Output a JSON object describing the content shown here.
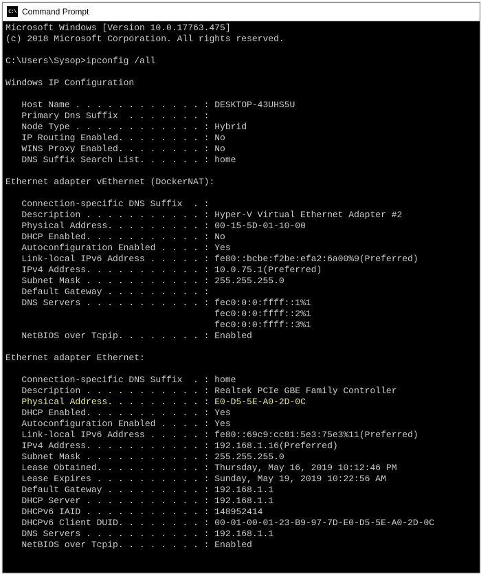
{
  "titlebar": {
    "icon_label": "C:\\",
    "title": "Command Prompt"
  },
  "header": {
    "line1": "Microsoft Windows [Version 10.0.17763.475]",
    "line2": "(c) 2018 Microsoft Corporation. All rights reserved."
  },
  "prompt": {
    "path": "C:\\Users\\Sysop>",
    "command": "ipconfig /all"
  },
  "section_main": "Windows IP Configuration",
  "main": [
    {
      "label": "   Host Name . . . . . . . . . . . . : ",
      "value": "DESKTOP-43UHS5U"
    },
    {
      "label": "   Primary Dns Suffix  . . . . . . . :",
      "value": ""
    },
    {
      "label": "   Node Type . . . . . . . . . . . . : ",
      "value": "Hybrid"
    },
    {
      "label": "   IP Routing Enabled. . . . . . . . : ",
      "value": "No"
    },
    {
      "label": "   WINS Proxy Enabled. . . . . . . . : ",
      "value": "No"
    },
    {
      "label": "   DNS Suffix Search List. . . . . . : ",
      "value": "home"
    }
  ],
  "section_a": "Ethernet adapter vEthernet (DockerNAT):",
  "adapter_a": [
    {
      "label": "   Connection-specific DNS Suffix  . :",
      "value": ""
    },
    {
      "label": "   Description . . . . . . . . . . . : ",
      "value": "Hyper-V Virtual Ethernet Adapter #2"
    },
    {
      "label": "   Physical Address. . . . . . . . . : ",
      "value": "00-15-5D-01-10-00"
    },
    {
      "label": "   DHCP Enabled. . . . . . . . . . . : ",
      "value": "No"
    },
    {
      "label": "   Autoconfiguration Enabled . . . . : ",
      "value": "Yes"
    },
    {
      "label": "   Link-local IPv6 Address . . . . . : ",
      "value": "fe80::bcbe:f2be:efa2:6a00%9(Preferred)"
    },
    {
      "label": "   IPv4 Address. . . . . . . . . . . : ",
      "value": "10.0.75.1(Preferred)"
    },
    {
      "label": "   Subnet Mask . . . . . . . . . . . : ",
      "value": "255.255.255.0"
    },
    {
      "label": "   Default Gateway . . . . . . . . . :",
      "value": ""
    },
    {
      "label": "   DNS Servers . . . . . . . . . . . : ",
      "value": "fec0:0:0:ffff::1%1"
    },
    {
      "label": "                                       ",
      "value": "fec0:0:0:ffff::2%1"
    },
    {
      "label": "                                       ",
      "value": "fec0:0:0:ffff::3%1"
    },
    {
      "label": "   NetBIOS over Tcpip. . . . . . . . : ",
      "value": "Enabled"
    }
  ],
  "section_b": "Ethernet adapter Ethernet:",
  "adapter_b": [
    {
      "label": "   Connection-specific DNS Suffix  . : ",
      "value": "home",
      "hl": false
    },
    {
      "label": "   Description . . . . . . . . . . . : ",
      "value": "Realtek PCIe GBE Family Controller",
      "hl": false
    },
    {
      "label": "   Physical Address. . . . . . . . . : ",
      "value": "E0-D5-5E-A0-2D-0C",
      "hl": true
    },
    {
      "label": "   DHCP Enabled. . . . . . . . . . . : ",
      "value": "Yes",
      "hl": false
    },
    {
      "label": "   Autoconfiguration Enabled . . . . : ",
      "value": "Yes",
      "hl": false
    },
    {
      "label": "   Link-local IPv6 Address . . . . . : ",
      "value": "fe80::69c9:cc81:5e3:75e3%11(Preferred)",
      "hl": false
    },
    {
      "label": "   IPv4 Address. . . . . . . . . . . : ",
      "value": "192.168.1.16(Preferred)",
      "hl": false
    },
    {
      "label": "   Subnet Mask . . . . . . . . . . . : ",
      "value": "255.255.255.0",
      "hl": false
    },
    {
      "label": "   Lease Obtained. . . . . . . . . . : ",
      "value": "Thursday, May 16, 2019 10:12:46 PM",
      "hl": false
    },
    {
      "label": "   Lease Expires . . . . . . . . . . : ",
      "value": "Sunday, May 19, 2019 10:22:56 AM",
      "hl": false
    },
    {
      "label": "   Default Gateway . . . . . . . . . : ",
      "value": "192.168.1.1",
      "hl": false
    },
    {
      "label": "   DHCP Server . . . . . . . . . . . : ",
      "value": "192.168.1.1",
      "hl": false
    },
    {
      "label": "   DHCPv6 IAID . . . . . . . . . . . : ",
      "value": "148952414",
      "hl": false
    },
    {
      "label": "   DHCPv6 Client DUID. . . . . . . . : ",
      "value": "00-01-00-01-23-B9-97-7D-E0-D5-5E-A0-2D-0C",
      "hl": false
    },
    {
      "label": "   DNS Servers . . . . . . . . . . . : ",
      "value": "192.168.1.1",
      "hl": false
    },
    {
      "label": "   NetBIOS over Tcpip. . . . . . . . : ",
      "value": "Enabled",
      "hl": false
    }
  ]
}
